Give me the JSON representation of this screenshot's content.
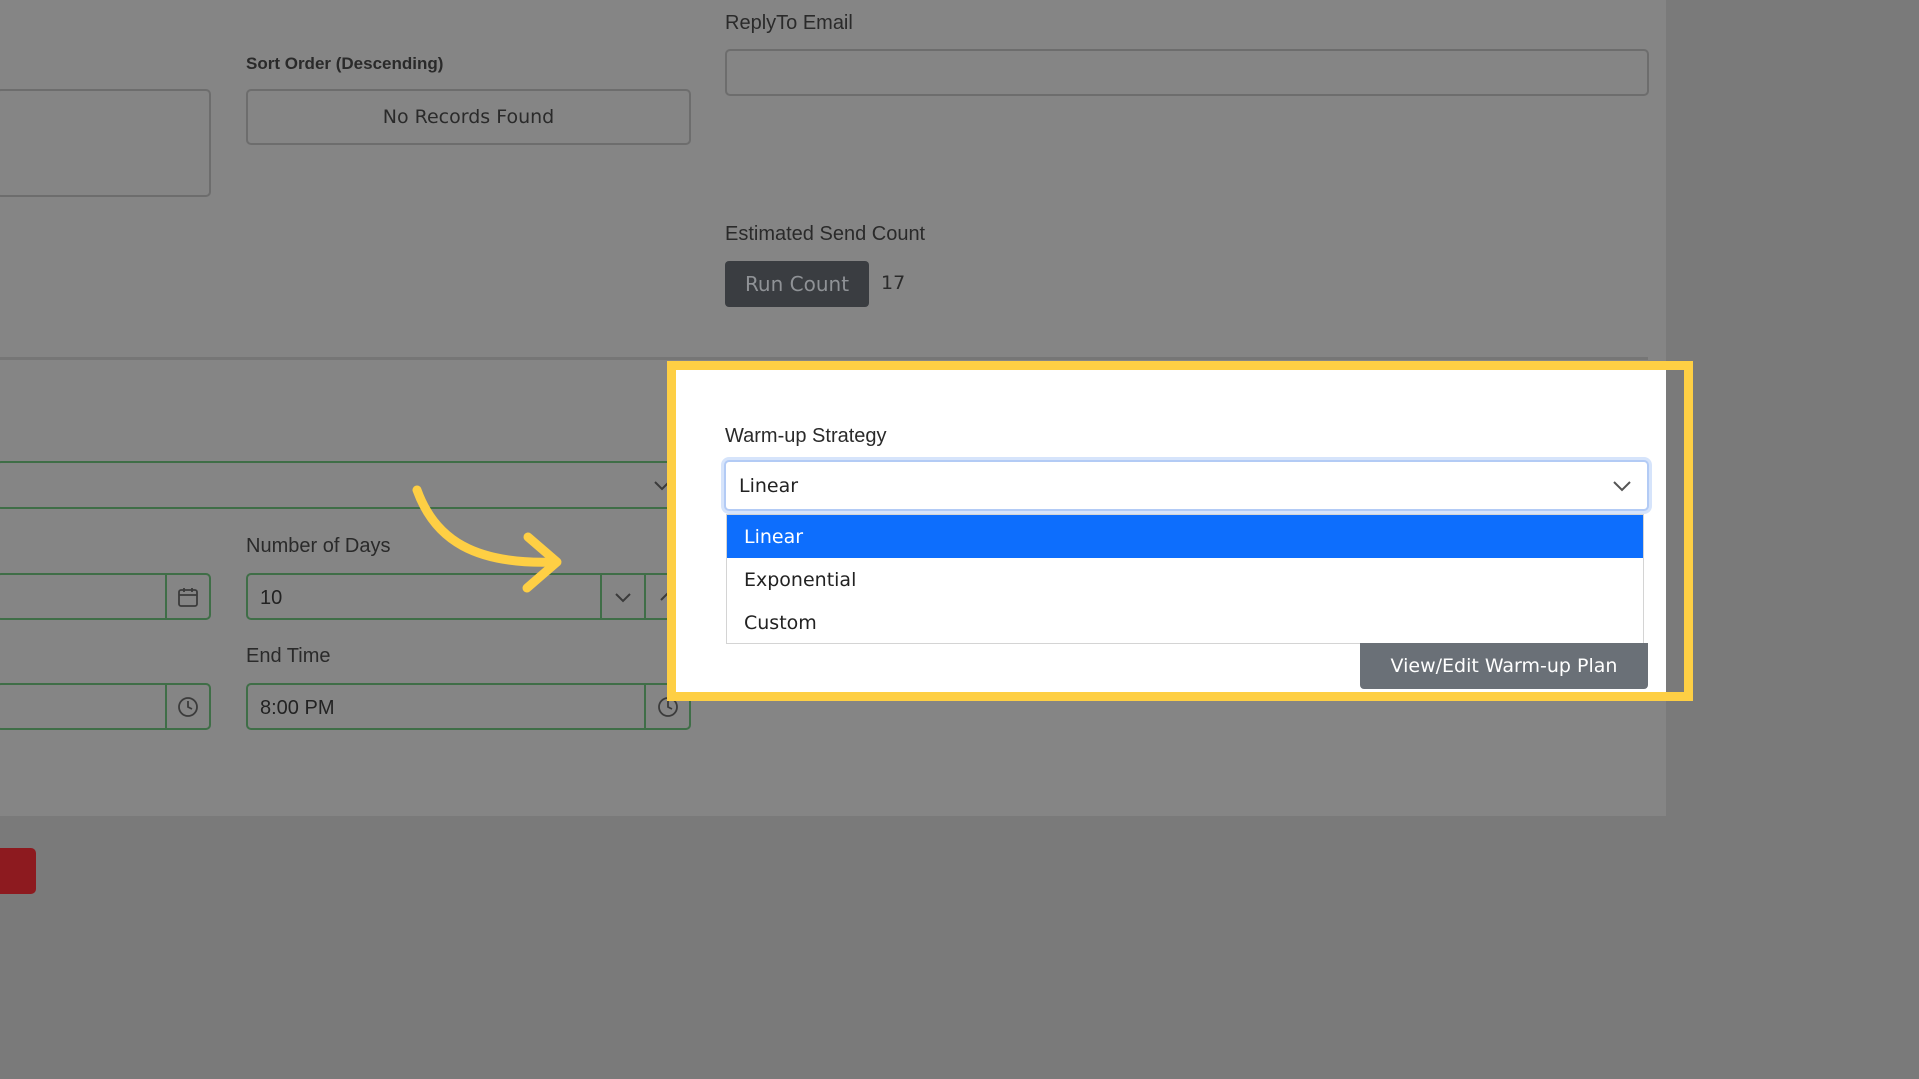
{
  "left_column": {
    "sort_order_label": "Sort Order (Descending)",
    "sort_order_value": "No Records Found",
    "number_of_days_label": "Number of Days",
    "number_of_days_value": "10",
    "end_time_label": "End Time",
    "end_time_value": "8:00 PM"
  },
  "right_column": {
    "reply_to_label": "ReplyTo Email",
    "reply_to_value": "",
    "estimated_send_count_label": "Estimated Send Count",
    "run_count_label": "Run Count",
    "count_value": "17"
  },
  "warmup": {
    "label": "Warm-up Strategy",
    "selected": "Linear",
    "options": [
      {
        "label": "Linear",
        "selected": true
      },
      {
        "label": "Exponential",
        "selected": false
      },
      {
        "label": "Custom",
        "selected": false
      }
    ],
    "view_edit_label": "View/Edit Warm-up Plan"
  },
  "colors": {
    "highlight": "#fecf44",
    "option_selected": "#0d6efd",
    "danger": "#8d1a1f"
  },
  "icons": [
    "calendar-icon",
    "clock-icon",
    "chevron-down-icon",
    "chevron-up-icon",
    "arrow-annotation"
  ]
}
